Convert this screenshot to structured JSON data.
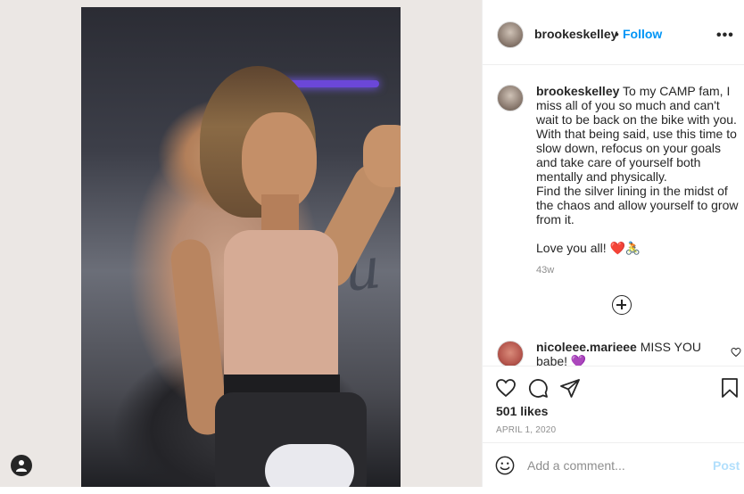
{
  "post": {
    "username": "brookeskelley",
    "separator": "•",
    "follow_label": "Follow",
    "more_label": "•••",
    "caption": {
      "username": "brookeskelley",
      "line1": "To my CAMP fam, I miss all of you so much and can't wait to be back on the bike with you.",
      "line2": "With that being said, use this time to slow down, refocus on your goals and take care of yourself both mentally and physically.",
      "line3": "Find the silver lining in the midst of the chaos and allow yourself to grow from it.",
      "line4": "Love you all! ❤️🚴"
    },
    "caption_age": "43w",
    "comment": {
      "username": "nicoleee.marieee",
      "text": "MISS YOU babe! 💜"
    },
    "likes": "501 likes",
    "date": "APRIL 1, 2020",
    "add_comment_placeholder": "Add a comment...",
    "post_label": "Post"
  },
  "photo": {
    "wall_text": "you"
  },
  "icons": [
    "user-tag-icon",
    "more-icon",
    "load-more-icon",
    "heart-icon",
    "comment-icon",
    "share-icon",
    "bookmark-icon",
    "emoji-icon"
  ],
  "colors": {
    "accent": "#0095f6",
    "post_disabled": "#b2dffc",
    "text": "#262626",
    "muted": "#8e8e8e"
  }
}
